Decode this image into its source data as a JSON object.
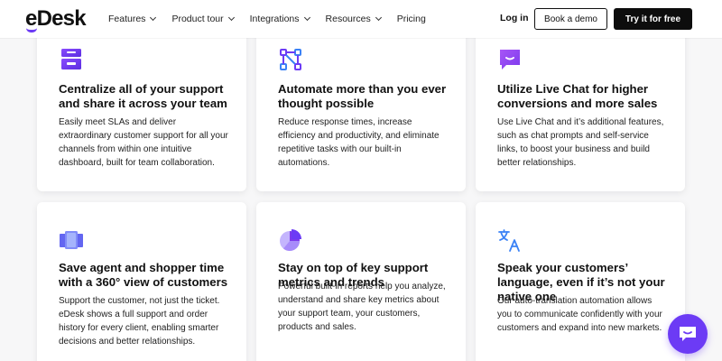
{
  "brand": {
    "logo": "eDesk",
    "accent": "#6c3bf5"
  },
  "nav": {
    "items": [
      {
        "label": "Features",
        "dropdown": true
      },
      {
        "label": "Product tour",
        "dropdown": true
      },
      {
        "label": "Integrations",
        "dropdown": true
      },
      {
        "label": "Resources",
        "dropdown": true
      },
      {
        "label": "Pricing",
        "dropdown": false
      }
    ],
    "login": "Log in",
    "demo": "Book a demo",
    "try": "Try it for free"
  },
  "cards": [
    {
      "icon": "inbox-tray-icon",
      "title": "Centralize all of your support and share it across your team",
      "body": "Easily meet SLAs and deliver extraordinary customer support for all your channels from within one intuitive dashboard, built for team collaboration."
    },
    {
      "icon": "workflow-nodes-icon",
      "title": "Automate more than you ever thought possible",
      "body": "Reduce response times, increase efficiency and productivity, and eliminate repetitive tasks with our built-in automations."
    },
    {
      "icon": "chat-bubble-icon",
      "title": "Utilize Live Chat for higher conversions and more sales",
      "body": "Use Live Chat and it’s additional features, such as chat prompts and self-service links, to boost your business and build better relationships."
    },
    {
      "icon": "stacked-cards-icon",
      "title": "Save agent and shopper time with a 360° view of customers",
      "body": "Support the customer, not just the ticket. eDesk shows a full support and order history for every client, enabling smarter decisions and better relationships."
    },
    {
      "icon": "pie-chart-icon",
      "title": "Stay on top of key support metrics and trends",
      "body": "Powerful built-in reports help you analyze, understand and share key metrics about your support team, your customers, products and sales."
    },
    {
      "icon": "translate-icon",
      "title": "Speak your customers’ language, even if it’s not your native one",
      "body": "Our auto-translation automation allows you to communicate confidently with your customers and expand into new markets."
    }
  ],
  "chat_widget": {
    "icon": "chat-widget-icon"
  }
}
